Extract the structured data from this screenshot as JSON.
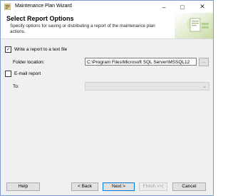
{
  "window": {
    "title": "Maintenance Plan Wizard"
  },
  "header": {
    "title": "Select Report Options",
    "subtitle": "Specify options for saving or distributing a report of the maintenance plan actions."
  },
  "report_to_file": {
    "label": "Write a report to a text file",
    "checked": true,
    "folder_label": "Folder location:",
    "folder_value": "C:\\Program Files\\Microsoft SQL Server\\MSSQL12",
    "browse_label": "..."
  },
  "email_report": {
    "label": "E-mail report",
    "checked": false,
    "to_label": "To:",
    "to_value": ""
  },
  "footer": {
    "help": "Help",
    "back": "< Back",
    "next": "Next >",
    "finish": "Finish >>|",
    "cancel": "Cancel"
  },
  "window_controls": {
    "minimize": "–",
    "maximize": "□",
    "close": "✕"
  },
  "colors": {
    "accent": "#0078d7",
    "header_graphic": "#c7dca7"
  },
  "icons": [
    "app-icon",
    "minimize-icon",
    "maximize-icon",
    "close-icon",
    "chevron-down-icon",
    "checkmark-icon"
  ]
}
